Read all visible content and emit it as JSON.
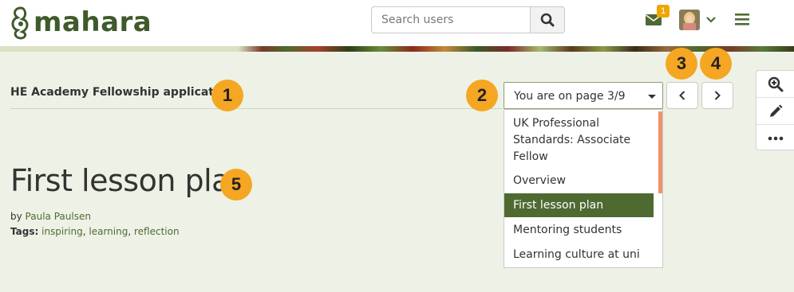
{
  "header": {
    "logo_text": "mahara",
    "search_placeholder": "Search users",
    "messages_count": "1"
  },
  "collection": {
    "title": "HE Academy Fellowship application",
    "page_select_label": "You are on page 3/9",
    "pages": [
      "UK Professional Standards: Associate Fellow",
      "Overview",
      "First lesson plan",
      "Mentoring students",
      "Learning culture at uni"
    ],
    "active_page": "First lesson plan"
  },
  "page": {
    "title": "First lesson plan",
    "by_label": "by",
    "author": "Paula Paulsen",
    "tags_label": "Tags:",
    "tags": [
      "inspiring",
      "learning",
      "reflection"
    ]
  },
  "callouts": [
    "1",
    "2",
    "3",
    "4",
    "5"
  ],
  "colors": {
    "accent": "#4f6a31",
    "callout": "#f5a623",
    "badge": "#f0a600",
    "background": "#eef2e6"
  },
  "icons": {
    "search": "search-icon",
    "messages": "envelope-icon",
    "menu": "hamburger-icon",
    "prev": "chevron-left-icon",
    "next": "chevron-right-icon",
    "zoom": "zoom-in-icon",
    "edit": "pencil-icon",
    "more": "more-icon"
  }
}
